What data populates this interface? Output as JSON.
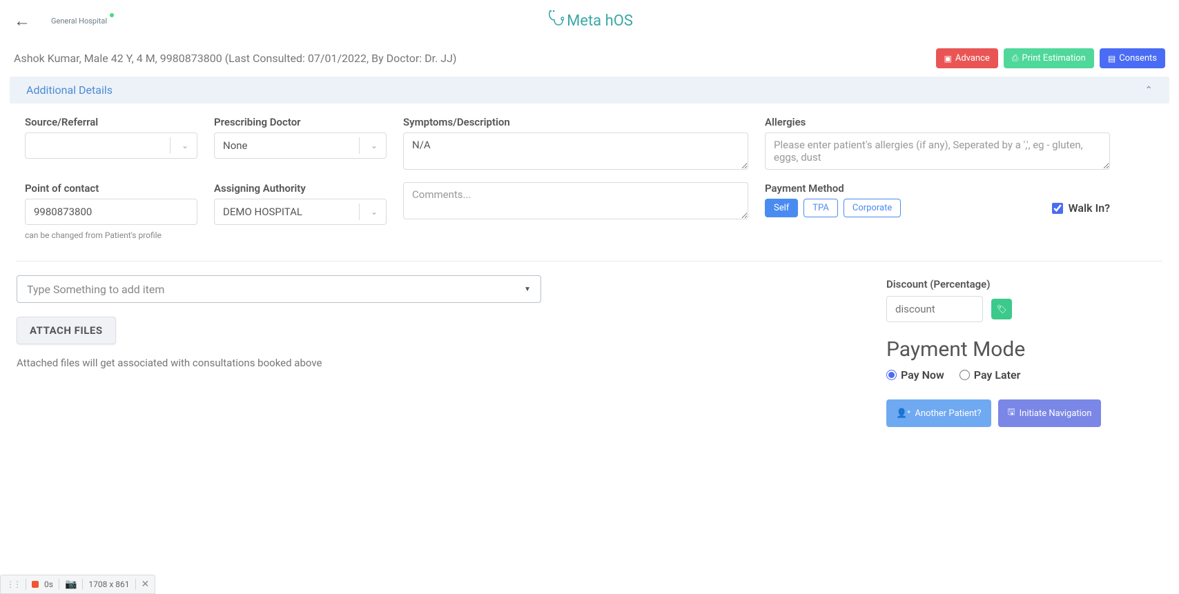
{
  "header": {
    "hospital_logo_text": "General\nHospital",
    "app_name": "Meta hOS"
  },
  "patient": {
    "summary": "Ashok Kumar, Male 42 Y, 4 M, 9980873800 (Last Consulted: 07/01/2022, By Doctor: Dr. JJ)"
  },
  "header_buttons": {
    "advance": "Advance",
    "print_estimation": "Print Estimation",
    "consents": "Consents"
  },
  "section": {
    "title": "Additional Details"
  },
  "fields": {
    "source_referral": {
      "label": "Source/Referral",
      "value": ""
    },
    "prescribing_doctor": {
      "label": "Prescribing Doctor",
      "value": "None"
    },
    "symptoms": {
      "label": "Symptoms/Description",
      "value": "N/A"
    },
    "allergies": {
      "label": "Allergies",
      "placeholder": "Please enter patient's allergies (if any), Seperated by a ',', eg - gluten, eggs, dust"
    },
    "point_of_contact": {
      "label": "Point of contact",
      "value": "9980873800",
      "helper": "can be changed from Patient's profile"
    },
    "assigning_authority": {
      "label": "Assigning Authority",
      "value": "DEMO HOSPITAL"
    },
    "comments": {
      "placeholder": "Comments..."
    },
    "payment_method": {
      "label": "Payment Method",
      "options": [
        "Self",
        "TPA",
        "Corporate"
      ],
      "selected": "Self"
    },
    "walk_in": {
      "label": "Walk In?",
      "checked": true
    }
  },
  "add_item": {
    "placeholder": "Type Something to add item"
  },
  "attach": {
    "button": "ATTACH FILES",
    "note": "Attached files will get associated with consultations booked above"
  },
  "discount": {
    "label": "Discount (Percentage)",
    "placeholder": "discount"
  },
  "payment_mode": {
    "title": "Payment Mode",
    "options": [
      "Pay Now",
      "Pay Later"
    ],
    "selected": "Pay Now"
  },
  "actions": {
    "another_patient": "Another Patient?",
    "initiate_navigation": "Initiate Navigation"
  },
  "recbar": {
    "time": "0s",
    "dimensions": "1708 x 861"
  }
}
